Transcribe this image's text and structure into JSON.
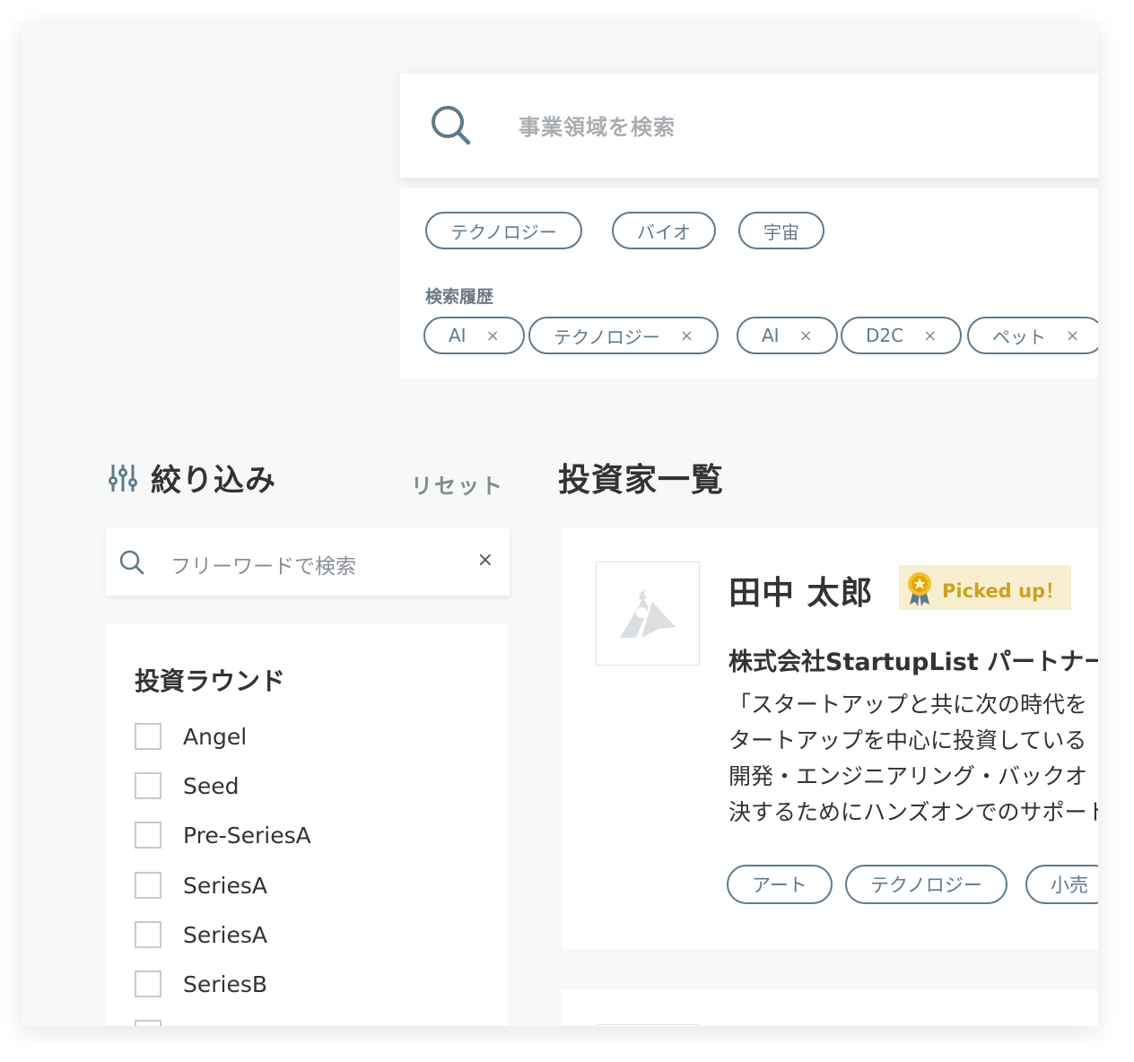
{
  "search": {
    "placeholder": "事業領域を検索"
  },
  "suggestions": [
    "テクノロジー",
    "バイオ",
    "宇宙"
  ],
  "history": {
    "label": "検索履歴",
    "items": [
      "AI",
      "テクノロジー",
      "AI",
      "D2C",
      "ペット"
    ],
    "remove_glyph": "×"
  },
  "filter": {
    "title": "絞り込み",
    "reset_label": "リセット",
    "free_search_placeholder": "フリーワードで検索",
    "clear_glyph": "×",
    "round_title": "投資ラウンド",
    "rounds": [
      "Angel",
      "Seed",
      "Pre-SeriesA",
      "SeriesA",
      "SeriesA",
      "SeriesB"
    ]
  },
  "list": {
    "title": "投資家一覧",
    "investor": {
      "name": "田中 太郎",
      "badge": "Picked up！",
      "company": "株式会社StartupList パートナー",
      "description": [
        "「スタートアップと共に次の時代を",
        "タートアップを中心に投資している",
        "開発・エンジニアリング・バックオ",
        "決するためにハンズオンでのサポート"
      ],
      "tags": [
        "アート",
        "テクノロジー",
        "小売"
      ]
    }
  },
  "colors": {
    "accent": "#5f7a8b",
    "badge_bg": "#f8efd1",
    "badge_text": "#c9a320"
  }
}
